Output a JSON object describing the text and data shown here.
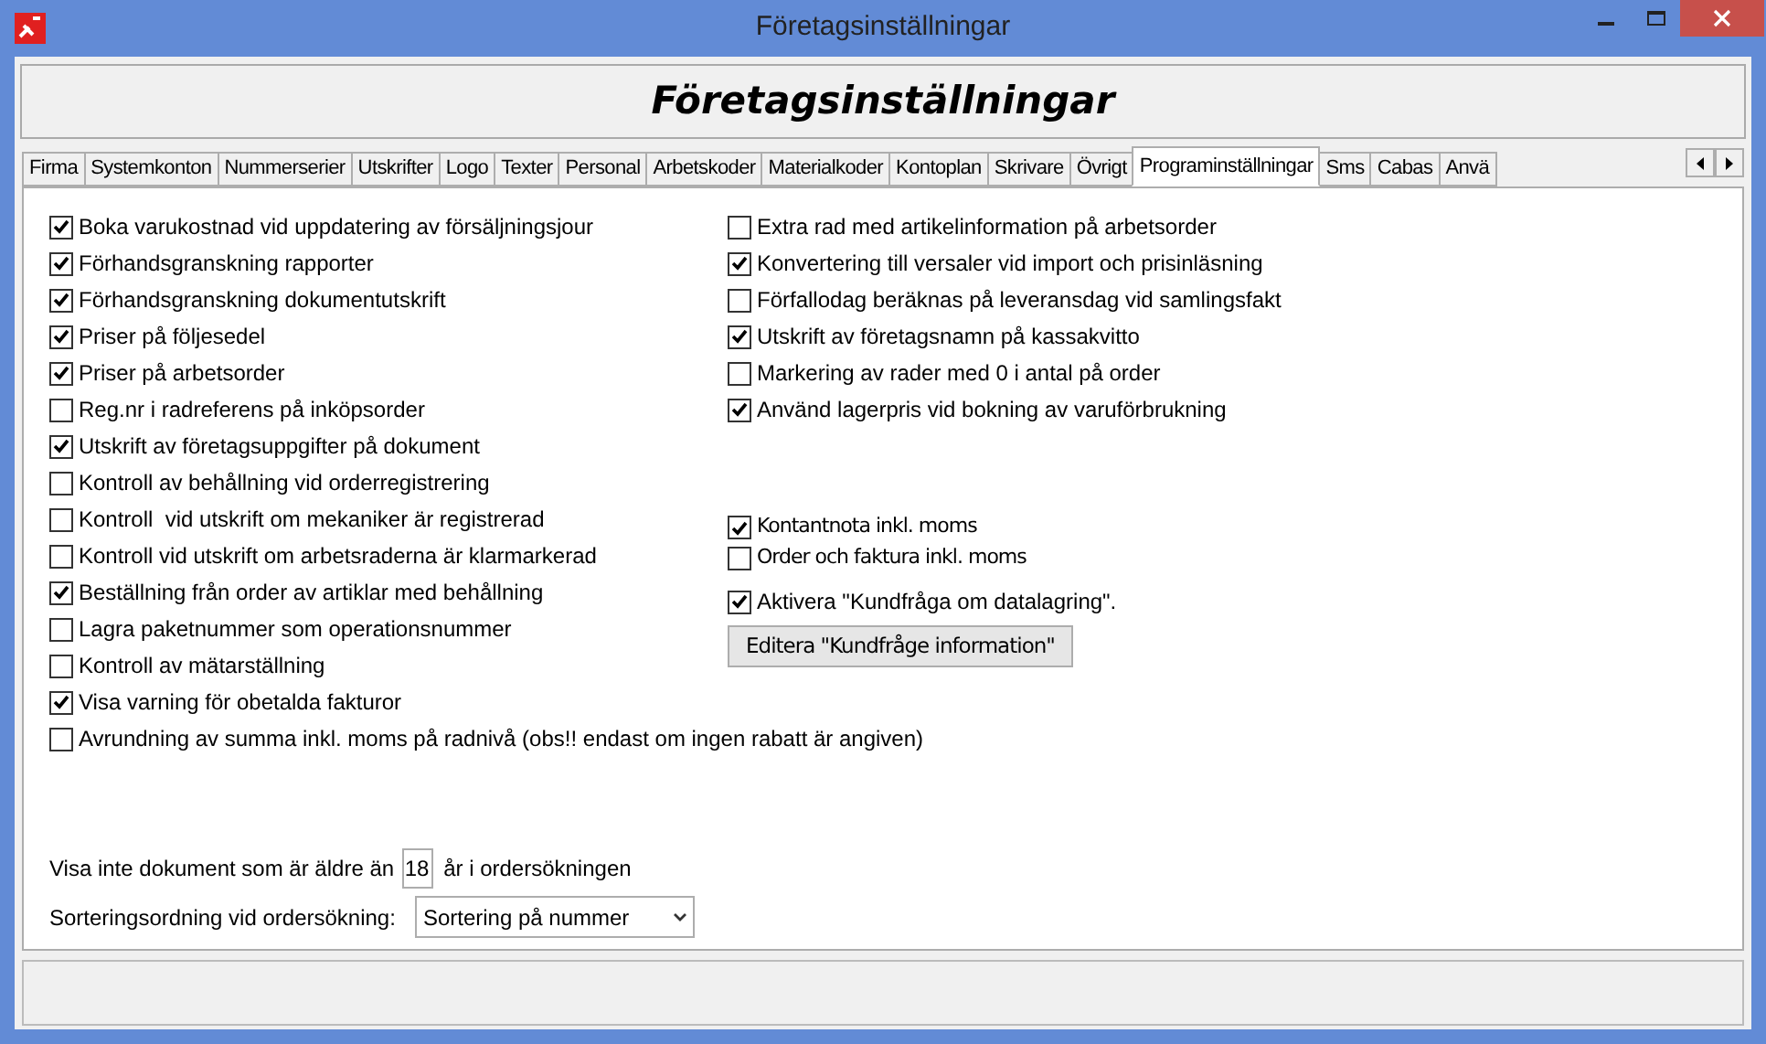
{
  "window": {
    "title": "Företagsinställningar"
  },
  "header": {
    "title": "Företagsinställningar"
  },
  "tabs": [
    {
      "label": "Firma",
      "selected": false
    },
    {
      "label": "Systemkonton",
      "selected": false
    },
    {
      "label": "Nummerserier",
      "selected": false
    },
    {
      "label": "Utskrifter",
      "selected": false
    },
    {
      "label": "Logo",
      "selected": false
    },
    {
      "label": "Texter",
      "selected": false
    },
    {
      "label": "Personal",
      "selected": false
    },
    {
      "label": "Arbetskoder",
      "selected": false
    },
    {
      "label": "Materialkoder",
      "selected": false
    },
    {
      "label": "Kontoplan",
      "selected": false
    },
    {
      "label": "Skrivare",
      "selected": false
    },
    {
      "label": "Övrigt",
      "selected": false
    },
    {
      "label": "Programinställningar",
      "selected": true
    },
    {
      "label": "Sms",
      "selected": false
    },
    {
      "label": "Cabas",
      "selected": false
    },
    {
      "label": "Anvä",
      "selected": false
    }
  ],
  "left_options": [
    {
      "label": "Boka varukostnad vid uppdatering av försäljningsjour",
      "checked": true
    },
    {
      "label": "Förhandsgranskning rapporter",
      "checked": true
    },
    {
      "label": "Förhandsgranskning dokumentutskrift",
      "checked": true
    },
    {
      "label": "Priser på följesedel",
      "checked": true
    },
    {
      "label": "Priser på arbetsorder",
      "checked": true
    },
    {
      "label": "Reg.nr i radreferens på inköpsorder",
      "checked": false
    },
    {
      "label": "Utskrift av företagsuppgifter på dokument",
      "checked": true
    },
    {
      "label": "Kontroll av behållning vid orderregistrering",
      "checked": false
    },
    {
      "label": "Kontroll  vid utskrift om mekaniker är registrerad",
      "checked": false
    },
    {
      "label": "Kontroll vid utskrift om arbetsraderna är klarmarkerad",
      "checked": false
    },
    {
      "label": "Beställning från order av artiklar med behållning",
      "checked": true
    },
    {
      "label": "Lagra paketnummer som operationsnummer",
      "checked": false
    },
    {
      "label": "Kontroll av mätarställning",
      "checked": false
    },
    {
      "label": "Visa varning för obetalda fakturor",
      "checked": true
    },
    {
      "label": "Avrundning av summa inkl. moms på radnivå (obs!! endast om ingen rabatt är angiven)",
      "checked": false
    }
  ],
  "right_options": [
    {
      "label": "Extra rad med artikelinformation på arbetsorder",
      "checked": false
    },
    {
      "label": "Konvertering till versaler vid import och prisinläsning",
      "checked": true
    },
    {
      "label": "Förfallodag beräknas på leveransdag vid samlingsfakt",
      "checked": false
    },
    {
      "label": "Utskrift av företagsnamn på kassakvitto",
      "checked": true
    },
    {
      "label": "Markering av rader med 0 i antal på order",
      "checked": false
    },
    {
      "label": "Använd lagerpris vid bokning av varuförbrukning",
      "checked": true
    }
  ],
  "vat_options": [
    {
      "label": "Kontantnota inkl. moms",
      "checked": true
    },
    {
      "label": "Order och faktura inkl. moms",
      "checked": false
    }
  ],
  "data_storage_option": {
    "label": "Aktivera \"Kundfråga om datalagring\".",
    "checked": true
  },
  "edit_button": "Editera \"Kundfråge information\"",
  "age_filter": {
    "label_before": "Visa inte dokument som är äldre än",
    "value": "18",
    "label_after": "år i ordersökningen"
  },
  "sort_order": {
    "label": "Sorteringsordning vid ordersökning:",
    "value": "Sortering på nummer"
  }
}
